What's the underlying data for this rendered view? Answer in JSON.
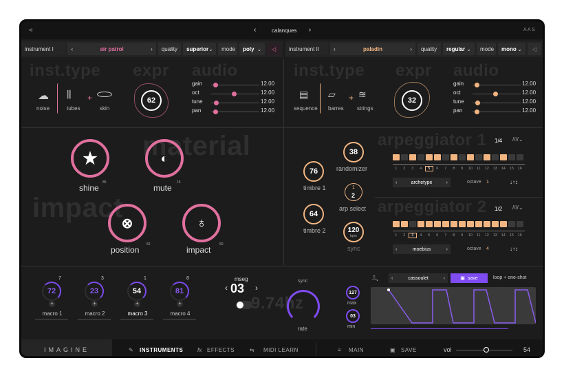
{
  "topbar": {
    "preset": "calanques",
    "brand_short": "A A S",
    "prev": "‹",
    "next": "›"
  },
  "inst1": {
    "label": "instrument I",
    "name": "air patrol",
    "quality_label": "quality",
    "quality": "superior",
    "mode_label": "mode",
    "mode": "poly",
    "sections": [
      "inst.type",
      "expr",
      "audio"
    ],
    "types": [
      "noise",
      "tubes",
      "skin"
    ],
    "plus": "+",
    "expr_value": "62",
    "audio": [
      {
        "label": "gain",
        "value": "12.00",
        "pos": 0.05
      },
      {
        "label": "oct",
        "value": "12.00",
        "pos": 0.45
      },
      {
        "label": "tune",
        "value": "12.00",
        "pos": 0.06
      },
      {
        "label": "pan",
        "value": "12.00",
        "pos": 0.05
      }
    ]
  },
  "inst2": {
    "label": "instrument II",
    "name": "paladin",
    "quality_label": "quality",
    "quality": "regular",
    "mode_label": "mode",
    "mode": "mono",
    "sections": [
      "inst.type",
      "expr",
      "audio"
    ],
    "types": [
      "sequence",
      "barres",
      "strings"
    ],
    "plus": "+",
    "expr_value": "32",
    "audio": [
      {
        "label": "gain",
        "value": "12.00",
        "pos": 0.05
      },
      {
        "label": "oct",
        "value": "12.00",
        "pos": 0.45
      },
      {
        "label": "tune",
        "value": "12.00",
        "pos": 0.06
      },
      {
        "label": "pan",
        "value": "12.00",
        "pos": 0.05
      }
    ]
  },
  "impact": {
    "ghost1": "material",
    "ghost2": "impact",
    "knobs": [
      {
        "label": "shine",
        "value": "85"
      },
      {
        "label": "mute",
        "value": "15"
      },
      {
        "label": "position",
        "value": "52"
      },
      {
        "label": "impact",
        "value": "50"
      }
    ]
  },
  "mid": {
    "timbre1_label": "timbre 1",
    "timbre1": "76",
    "timbre2_label": "timbre 2",
    "timbre2": "64",
    "randomizer_label": "randomizer",
    "randomizer": "38",
    "arp_select_label": "arp select",
    "arp_top": "1",
    "arp_bottom": "2",
    "bpm": "120",
    "bpm_unit": "bpm",
    "sync_label": "sync"
  },
  "arp1": {
    "title": "arpeggiator 1",
    "rate": "1/4",
    "pattern_label": "archetype",
    "octave_label": "octave",
    "octave": "1",
    "steps": [
      1,
      0,
      1,
      0,
      1,
      1,
      0,
      1,
      0,
      1,
      0,
      1,
      0,
      1,
      0,
      0
    ],
    "numbers": [
      "1",
      "2",
      "3",
      "4",
      "5",
      "6",
      "7",
      "8",
      "9",
      "10",
      "11",
      "12",
      "13",
      "14",
      "15",
      "16"
    ],
    "active_step": "5"
  },
  "arp2": {
    "title": "arpeggiator 2",
    "rate": "1/2",
    "pattern_label": "moebius",
    "octave_label": "octave",
    "octave": "4",
    "steps": [
      1,
      1,
      0,
      1,
      1,
      1,
      1,
      1,
      1,
      1,
      1,
      1,
      1,
      1,
      0,
      0
    ],
    "numbers": [
      "1",
      "2",
      "3",
      "4",
      "5",
      "6",
      "7",
      "8",
      "9",
      "10",
      "11",
      "12",
      "13",
      "14",
      "15",
      "16"
    ],
    "active_step": "3"
  },
  "macros": [
    {
      "label": "macro 1",
      "value": "72",
      "sup": "7",
      "level": 0.72
    },
    {
      "label": "macro 2",
      "value": "23",
      "sup": "3",
      "level": 0.23
    },
    {
      "label": "macro 3",
      "value": "54",
      "sup": "1",
      "level": 0.54
    },
    {
      "label": "macro 4",
      "value": "81",
      "sup": "8",
      "level": 0.81
    }
  ],
  "mseg": {
    "label": "mseg",
    "value": "03",
    "sync_label": "sync",
    "freq": "9.74hz",
    "rate_label": "rate",
    "max_label": "max",
    "max": "127",
    "min_label": "min",
    "min": "03",
    "preset": "cassoulet",
    "save": "save",
    "loop": "loop + one-shot"
  },
  "bottom": {
    "logo": "IMAGINE",
    "instruments": "INSTRUMENTS",
    "effects": "EFFECTS",
    "effects_prefix": "fx",
    "midi": "MIDI LEARN",
    "main": "MAIN",
    "save": "SAVE",
    "vol_label": "vol",
    "vol": "54"
  },
  "colors": {
    "pink": "#e0709e",
    "orange": "#f2b582",
    "purple": "#7e4cf0",
    "bg": "#1c1c1c"
  }
}
